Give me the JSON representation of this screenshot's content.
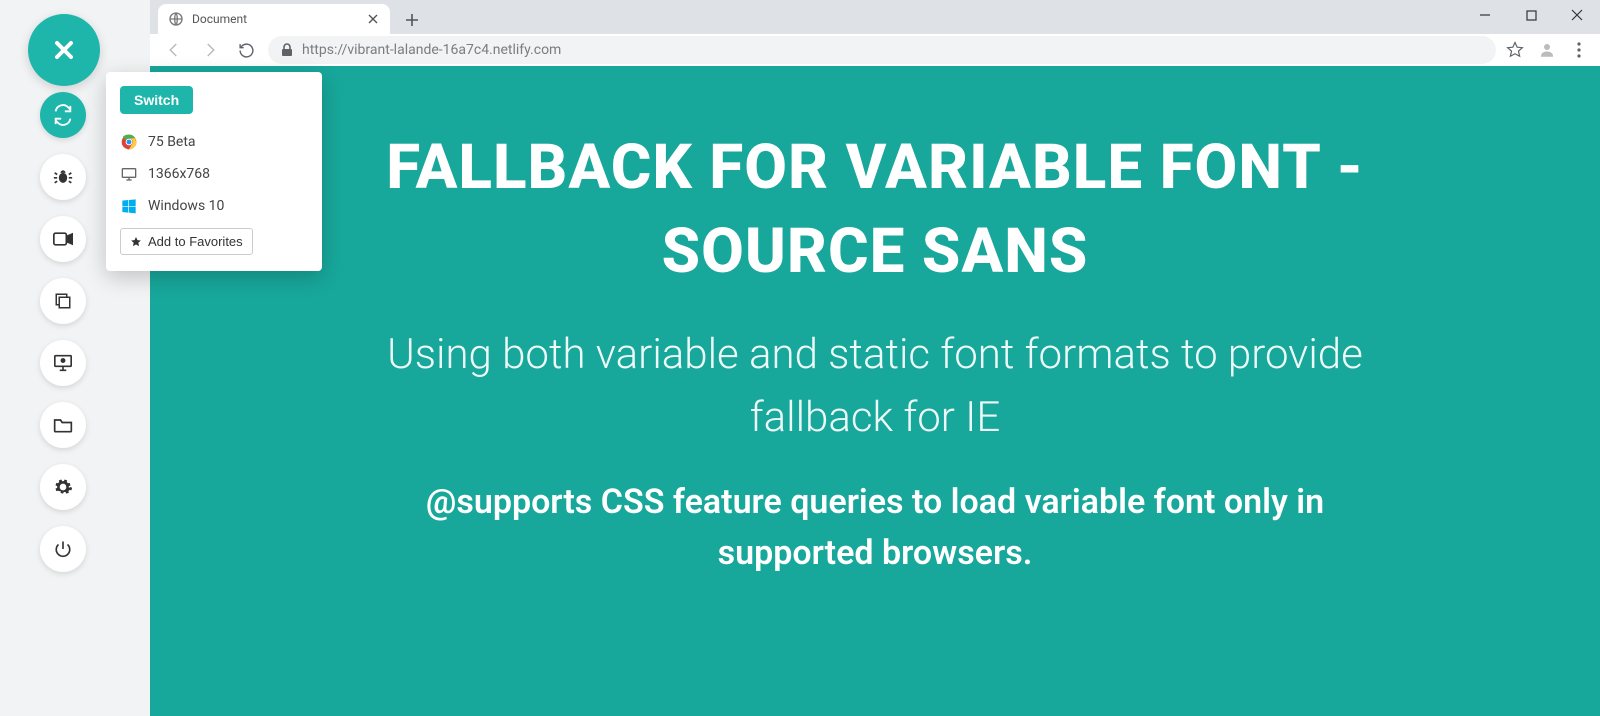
{
  "colors": {
    "accent": "#1eb6aa",
    "page_bg": "#18a79b"
  },
  "browser": {
    "tab_title": "Document",
    "url": "https://vibrant-lalande-16a7c4.netlify.com"
  },
  "sidebar": {
    "close_label": "Close",
    "icons": [
      {
        "name": "switch-browser-icon",
        "active": true
      },
      {
        "name": "bug-icon",
        "active": false
      },
      {
        "name": "video-icon",
        "active": false
      },
      {
        "name": "copy-icon",
        "active": false
      },
      {
        "name": "local-testing-icon",
        "active": false
      },
      {
        "name": "folder-icon",
        "active": false
      },
      {
        "name": "gear-icon",
        "active": false
      },
      {
        "name": "power-icon",
        "active": false
      }
    ]
  },
  "popover": {
    "switch_label": "Switch",
    "browser_version": "75 Beta",
    "resolution": "1366x768",
    "os": "Windows 10",
    "favorites_label": "Add to Favorites"
  },
  "page": {
    "heading": "FALLBACK FOR VARIABLE FONT - SOURCE SANS",
    "subtitle": "Using both variable and static font formats to provide fallback for IE",
    "supports": "@supports CSS feature queries to load variable font only in supported browsers."
  }
}
